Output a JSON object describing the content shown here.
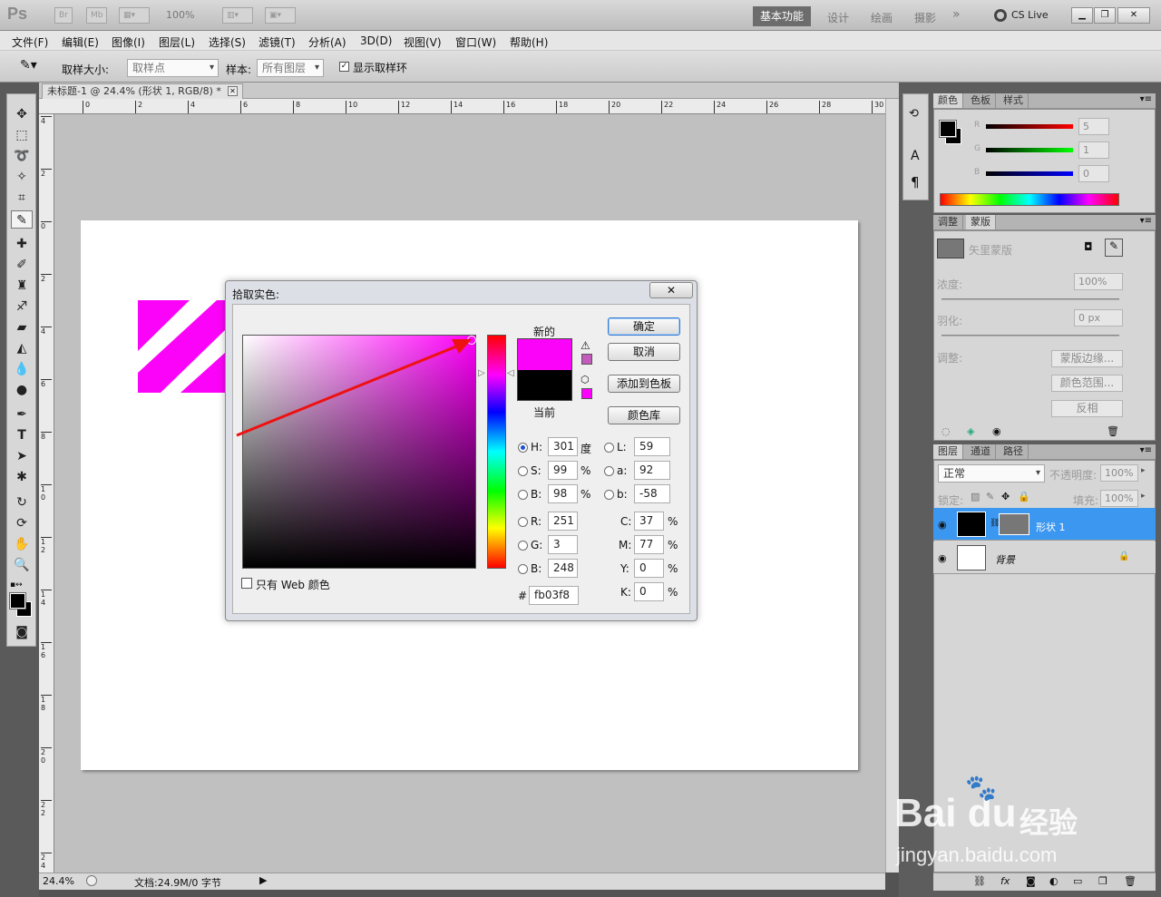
{
  "app": {
    "logo": "Ps",
    "zoom_combo": "100%",
    "workspaces": [
      "基本功能",
      "设计",
      "绘画",
      "摄影"
    ],
    "more": "»",
    "cslive": "CS Live"
  },
  "menu": [
    "文件(F)",
    "编辑(E)",
    "图像(I)",
    "图层(L)",
    "选择(S)",
    "滤镜(T)",
    "分析(A)",
    "3D(D)",
    "视图(V)",
    "窗口(W)",
    "帮助(H)"
  ],
  "options": {
    "sample_size_label": "取样大小:",
    "sample_size_value": "取样点",
    "sample_label": "样本:",
    "sample_value": "所有图层",
    "show_ring": "显示取样环"
  },
  "document": {
    "tab_title": "未标题-1 @ 24.4% (形状 1, RGB/8) *",
    "ruler_top": [
      "0",
      "2",
      "4",
      "6",
      "8",
      "10",
      "12",
      "14",
      "16",
      "18",
      "20",
      "22",
      "24",
      "26",
      "28",
      "30"
    ],
    "ruler_left": [
      "4",
      "2",
      "0",
      "2",
      "4",
      "6",
      "8",
      "1 0",
      "1 2",
      "1 4",
      "1 6",
      "1 8",
      "2 0",
      "2 2",
      "2 4"
    ],
    "status_zoom": "24.4%",
    "status_doc": "文档:24.9M/0 字节"
  },
  "color_picker": {
    "title": "拾取实色:",
    "new_label": "新的",
    "current_label": "当前",
    "new_color": "#fb03f8",
    "current_color": "#000000",
    "hue_color": "#ff00fa",
    "buttons": {
      "ok": "确定",
      "cancel": "取消",
      "add_swatch": "添加到色板",
      "libraries": "颜色库"
    },
    "web_only": "只有 Web 颜色",
    "H": "301",
    "S": "99",
    "Bv": "98",
    "R": "251",
    "G": "3",
    "B": "248",
    "L": "59",
    "a": "92",
    "b": "-58",
    "C": "37",
    "M": "77",
    "Y": "0",
    "K": "0",
    "hex": "fb03f8",
    "unit_deg": "度",
    "unit_pct": "%"
  },
  "panels": {
    "color_tabs": [
      "颜色",
      "色板",
      "样式"
    ],
    "color_R": "5",
    "color_G": "1",
    "color_B": "0",
    "adjust_tabs": [
      "调整",
      "蒙版"
    ],
    "vector_mask": "矢里蒙版",
    "density_label": "浓度:",
    "density_value": "100%",
    "feather_label": "羽化:",
    "feather_value": "0 px",
    "adjust_label": "调整:",
    "mask_edge": "蒙版边缘...",
    "color_range": "颜色范围...",
    "invert": "反相",
    "layers_tabs": [
      "图层",
      "通道",
      "路径"
    ],
    "blend_mode": "正常",
    "opacity_label": "不透明度:",
    "opacity_value": "100%",
    "lock_label": "锁定:",
    "fill_label": "填充:",
    "fill_value": "100%",
    "layers": [
      {
        "name": "形状 1",
        "selected": true
      },
      {
        "name": "背景",
        "selected": false
      }
    ]
  },
  "watermark": {
    "brand": "Bai du",
    "cn": "经验",
    "url": "jingyan.baidu.com"
  }
}
